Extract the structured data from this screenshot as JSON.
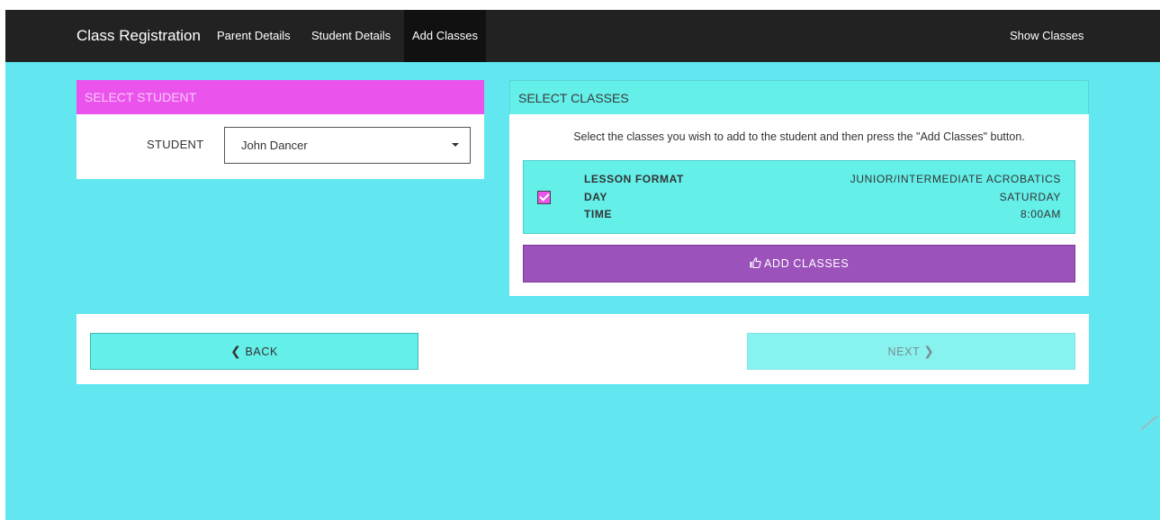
{
  "navbar": {
    "brand": "Class Registration",
    "links": [
      {
        "label": "Parent Details"
      },
      {
        "label": "Student Details"
      },
      {
        "label": "Add Classes"
      }
    ],
    "right_link": "Show Classes"
  },
  "select_student": {
    "title": "SELECT STUDENT",
    "field_label": "STUDENT",
    "selected_value": "John Dancer"
  },
  "select_classes": {
    "title": "SELECT CLASSES",
    "instructions": "Select the classes you wish to add to the student and then press the \"Add Classes\" button.",
    "classes": [
      {
        "checked": true,
        "rows": [
          {
            "key": "LESSON FORMAT",
            "value": "JUNIOR/INTERMEDIATE ACROBATICS"
          },
          {
            "key": "DAY",
            "value": "SATURDAY"
          },
          {
            "key": "TIME",
            "value": "8:00AM"
          }
        ]
      }
    ],
    "add_button": "ADD CLASSES",
    "add_icon": "thumbs-up-icon"
  },
  "footer_nav": {
    "back_label": "BACK",
    "next_label": "NEXT"
  },
  "colors": {
    "navbar": "#222222",
    "background": "#62e7f1",
    "student_header": "#ea54ec",
    "classes_header": "#64efe9",
    "add_button": "#9b52bb"
  }
}
